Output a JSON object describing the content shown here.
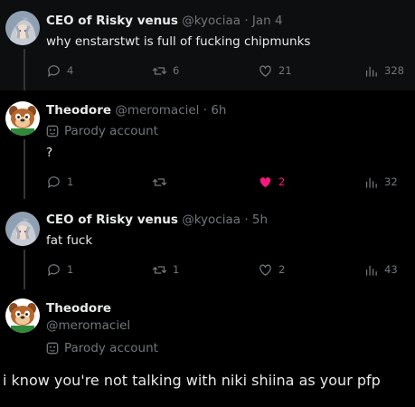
{
  "tweets": [
    {
      "name": "CEO of Risky venus",
      "handle": "@kyociaa",
      "dot_time": "· Jan 4",
      "text": "why enstarstwt is full of fucking chipmunks",
      "replies": "4",
      "retweets": "6",
      "likes": "21",
      "views": "328",
      "avatar": "grey-haired-anime-avatar"
    },
    {
      "name": "Theodore",
      "handle": "@meromaciel",
      "dot_time": "· 6h",
      "parody": "Parody account",
      "text": "?",
      "replies": "1",
      "retweets": "",
      "likes": "2",
      "views": "32",
      "liked": true,
      "avatar": "chipmunk-avatar"
    },
    {
      "name": "CEO of Risky venus",
      "handle": "@kyociaa",
      "dot_time": "· 5h",
      "text": "fat fuck",
      "replies": "1",
      "retweets": "1",
      "likes": "2",
      "views": "43",
      "avatar": "grey-haired-anime-avatar"
    },
    {
      "name": "Theodore",
      "handle": "@meromaciel",
      "parody": "Parody account",
      "avatar": "chipmunk-avatar"
    }
  ],
  "reply_text": "i know you're not talking with niki shiina as your pfp",
  "colors": {
    "background": "#000000",
    "text": "#e7e9ea",
    "muted": "#71767b",
    "like": "#f91880"
  }
}
